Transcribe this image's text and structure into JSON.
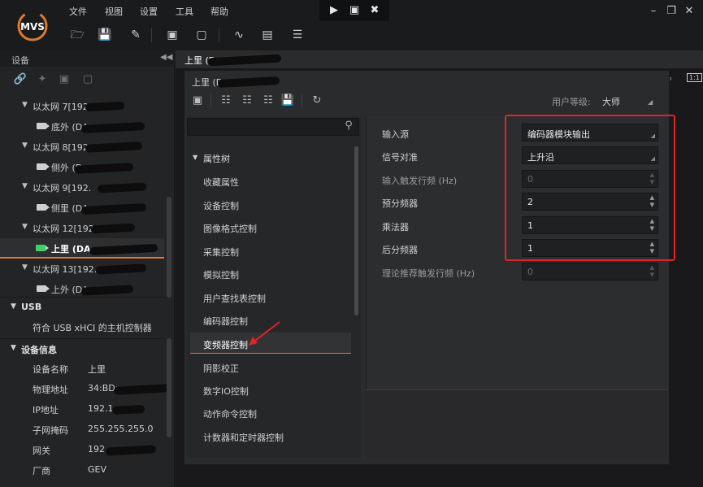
{
  "menu": {
    "file": "文件",
    "view": "视图",
    "settings": "设置",
    "tools": "工具",
    "help": "帮助"
  },
  "logo_text": "MVS",
  "devices_panel": {
    "title": "设备",
    "tree": [
      {
        "label": "以太网 7[192.",
        "type": "group"
      },
      {
        "label": "底外 (DA",
        "type": "camera"
      },
      {
        "label": "以太网 8[192.",
        "type": "group"
      },
      {
        "label": "侧外 (D",
        "type": "camera"
      },
      {
        "label": "以太网 9[192.",
        "type": "group"
      },
      {
        "label": "侧里 (DA",
        "type": "camera"
      },
      {
        "label": "以太网 12[192.",
        "type": "group"
      },
      {
        "label": "上里 (DA",
        "type": "camera-selected"
      },
      {
        "label": "以太网 13[192.",
        "type": "group"
      },
      {
        "label": "上外 (DA",
        "type": "camera"
      }
    ],
    "usb_header": "USB",
    "usb_item": "符合 USB xHCI 的主机控制器",
    "info_header": "设备信息",
    "info": [
      {
        "k": "设备名称",
        "v": "上里"
      },
      {
        "k": "物理地址",
        "v": "34:BD:"
      },
      {
        "k": "IP地址",
        "v": "192.1"
      },
      {
        "k": "子网掩码",
        "v": "255.255.255.0"
      },
      {
        "k": "网关",
        "v": "192."
      },
      {
        "k": "厂商",
        "v": "GEV"
      }
    ]
  },
  "main_tab_label": "上里 (D",
  "dialog": {
    "title": "上里 (D",
    "user_level_label": "用户等级:",
    "user_level_value": "大师",
    "feature_tree": {
      "root": "属性树",
      "items": [
        "收藏属性",
        "设备控制",
        "图像格式控制",
        "采集控制",
        "模拟控制",
        "用户查找表控制",
        "编码器控制",
        "变频器控制",
        "阴影校正",
        "数字IO控制",
        "动作命令控制",
        "计数器和定时器控制"
      ],
      "selected": "变频器控制"
    },
    "properties": [
      {
        "name": "输入源",
        "value": "编码器模块输出",
        "kind": "dropdown",
        "enabled": true
      },
      {
        "name": "信号对准",
        "value": "上升沿",
        "kind": "dropdown",
        "enabled": true
      },
      {
        "name": "输入触发行频 (Hz)",
        "value": "0",
        "kind": "spin",
        "enabled": false
      },
      {
        "name": "预分频器",
        "value": "2",
        "kind": "spin",
        "enabled": true
      },
      {
        "name": "乘法器",
        "value": "1",
        "kind": "spin",
        "enabled": true
      },
      {
        "name": "后分频器",
        "value": "1",
        "kind": "spin",
        "enabled": true
      },
      {
        "name": "理论推荐触发行频 (Hz)",
        "value": "0",
        "kind": "spin",
        "enabled": false
      }
    ]
  },
  "side_icon_ratio": "1:1",
  "colors": {
    "accent": "#e07a2f",
    "highlight_box": "#e52323",
    "background": "#1e1f21"
  }
}
